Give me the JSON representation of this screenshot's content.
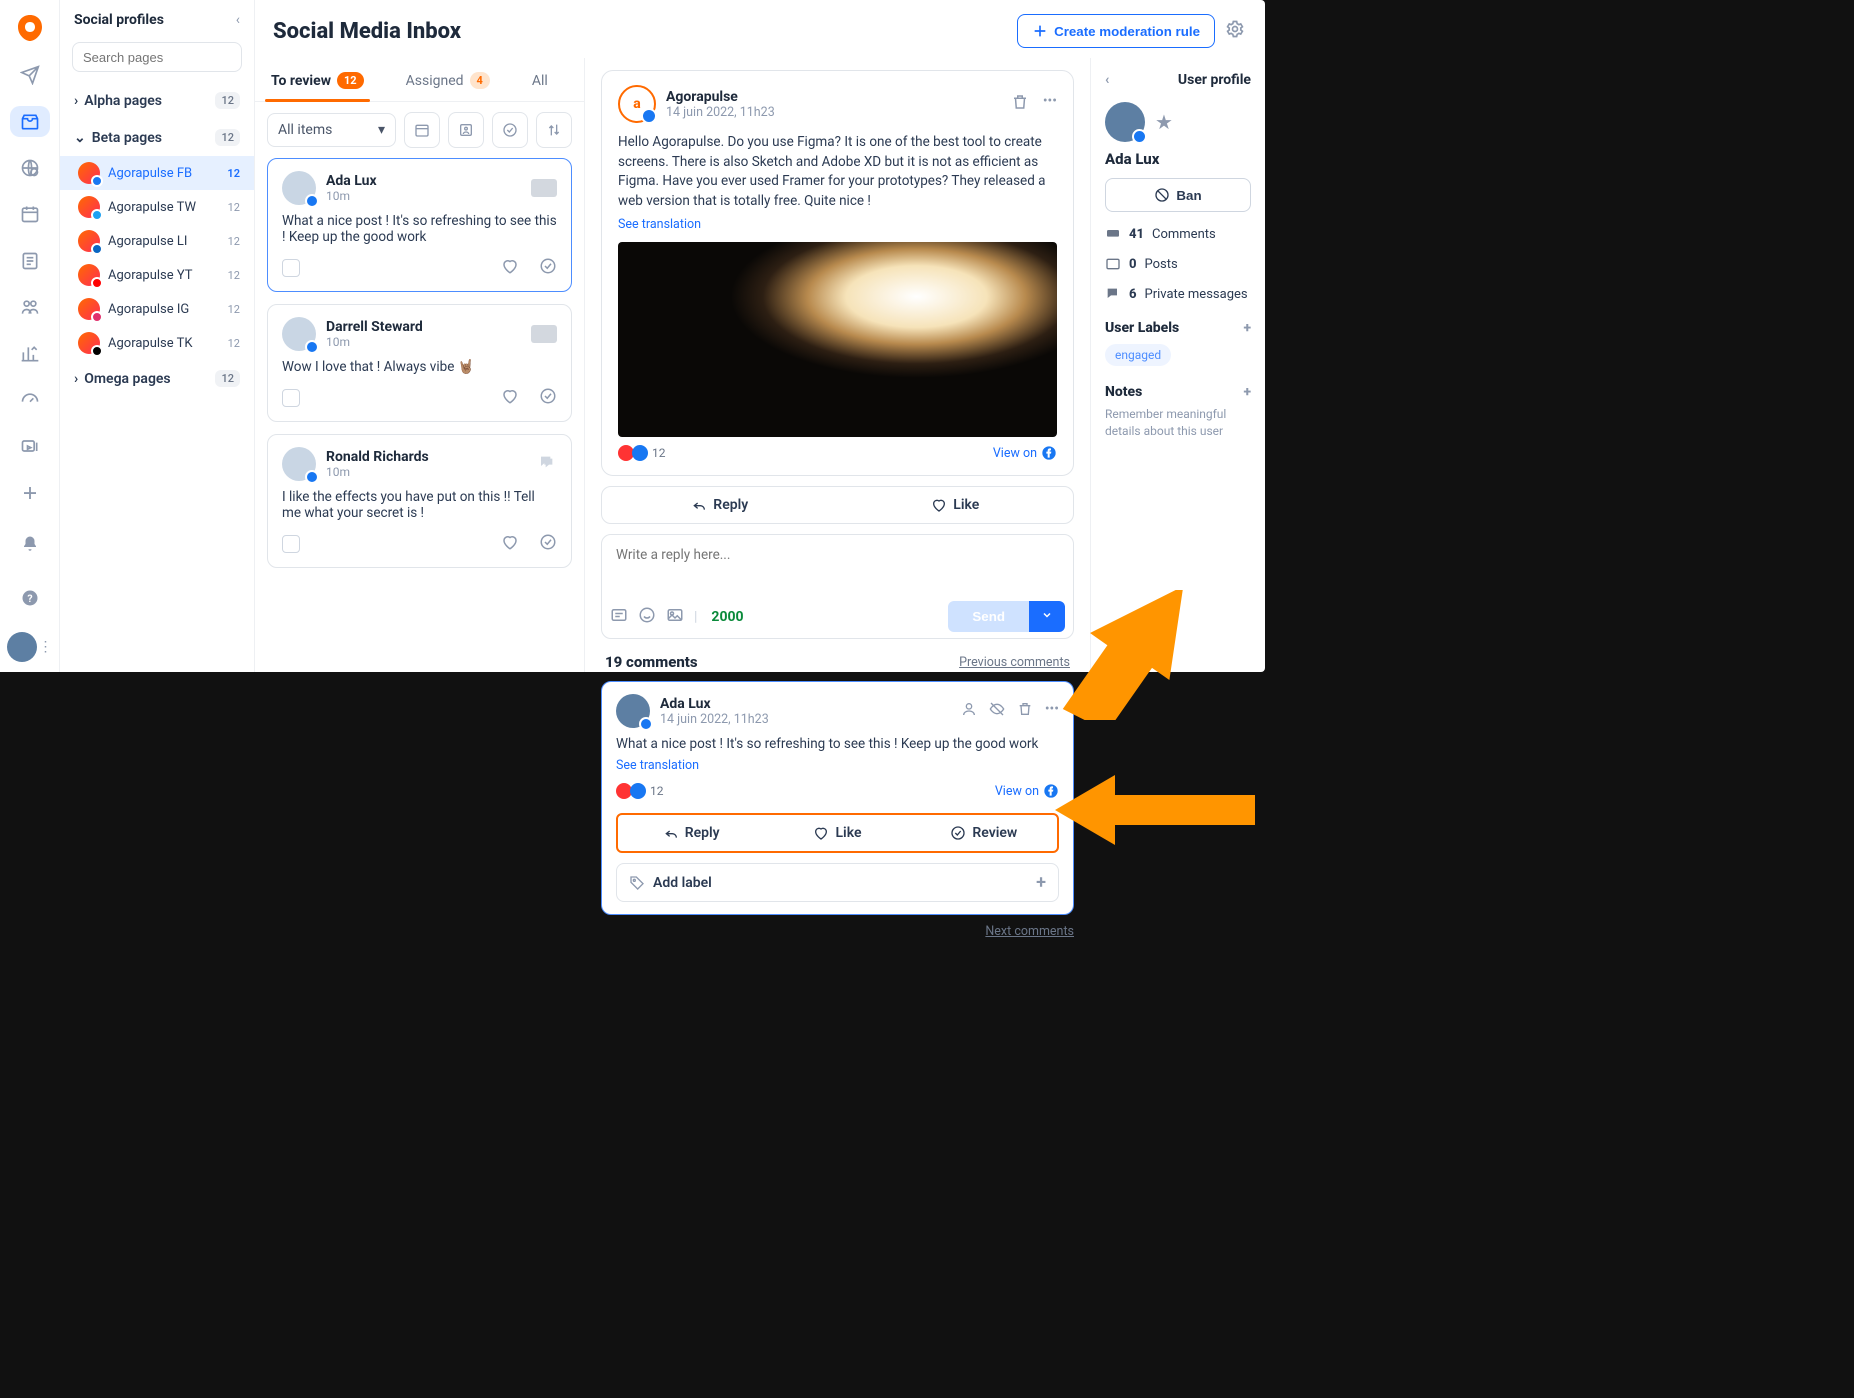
{
  "header": {
    "title": "Social Media Inbox",
    "create_rule": "Create moderation rule"
  },
  "sidebar": {
    "title": "Social profiles",
    "search_placeholder": "Search pages",
    "groups": [
      {
        "name": "Alpha pages",
        "count": "12",
        "open": false
      },
      {
        "name": "Beta pages",
        "count": "12",
        "open": true,
        "pages": [
          {
            "label": "Agorapulse FB",
            "count": "12",
            "net": "#1877f2",
            "active": true
          },
          {
            "label": "Agorapulse TW",
            "count": "12",
            "net": "#1da1f2"
          },
          {
            "label": "Agorapulse LI",
            "count": "12",
            "net": "#0a66c2"
          },
          {
            "label": "Agorapulse YT",
            "count": "12",
            "net": "#ff0000"
          },
          {
            "label": "Agorapulse IG",
            "count": "12",
            "net": "#e1306c"
          },
          {
            "label": "Agorapulse TK",
            "count": "12",
            "net": "#000000"
          }
        ]
      },
      {
        "name": "Omega pages",
        "count": "12",
        "open": false
      }
    ]
  },
  "tabs": {
    "review": "To review",
    "review_count": "12",
    "assigned": "Assigned",
    "assigned_count": "4",
    "all": "All"
  },
  "filter": {
    "all_items": "All items"
  },
  "items": [
    {
      "name": "Ada Lux",
      "time": "10m",
      "text": "What a nice post ! It's so refreshing to see this ! Keep up the good work",
      "thumb": true
    },
    {
      "name": "Darrell Steward",
      "time": "10m",
      "text": "Wow I love that ! Always vibe 🤘🏽",
      "thumb": true
    },
    {
      "name": "Ronald Richards",
      "time": "10m",
      "text": "I like the effects you have put on this !! Tell me what your secret is !",
      "thumb": false,
      "bubble": true
    }
  ],
  "post": {
    "author": "Agorapulse",
    "date": "14 juin 2022, 11h23",
    "text": "Hello Agorapulse. Do you use Figma? It is one of the best tool to create screens. There is also Sketch and Adobe XD but it is not as efficient as Figma. Have you ever used Framer for your prototypes? They released a web version that is totally free. Quite nice !",
    "see_translation": "See translation",
    "react_count": "12",
    "view_on": "View on",
    "reply": "Reply",
    "like": "Like",
    "review": "Review",
    "reply_placeholder": "Write a reply here...",
    "char_count": "2000",
    "send": "Send"
  },
  "comments": {
    "count_label": "19 comments",
    "prev": "Previous comments",
    "next": "Next comments",
    "featured": {
      "name": "Ada Lux",
      "date": "14 juin 2022, 11h23",
      "text": "What a nice post ! It's so refreshing to see this ! Keep up the good work",
      "see_translation": "See translation",
      "react_count": "12",
      "view_on": "View on"
    },
    "add_label": "Add label"
  },
  "profile": {
    "heading": "User profile",
    "name": "Ada Lux",
    "ban": "Ban",
    "stats": {
      "comments_n": "41",
      "comments": "Comments",
      "posts_n": "0",
      "posts": "Posts",
      "pm_n": "6",
      "pm": "Private messages"
    },
    "labels_hd": "User Labels",
    "label_chip": "engaged",
    "notes_hd": "Notes",
    "notes_hint": "Remember meaningful details about this user"
  }
}
